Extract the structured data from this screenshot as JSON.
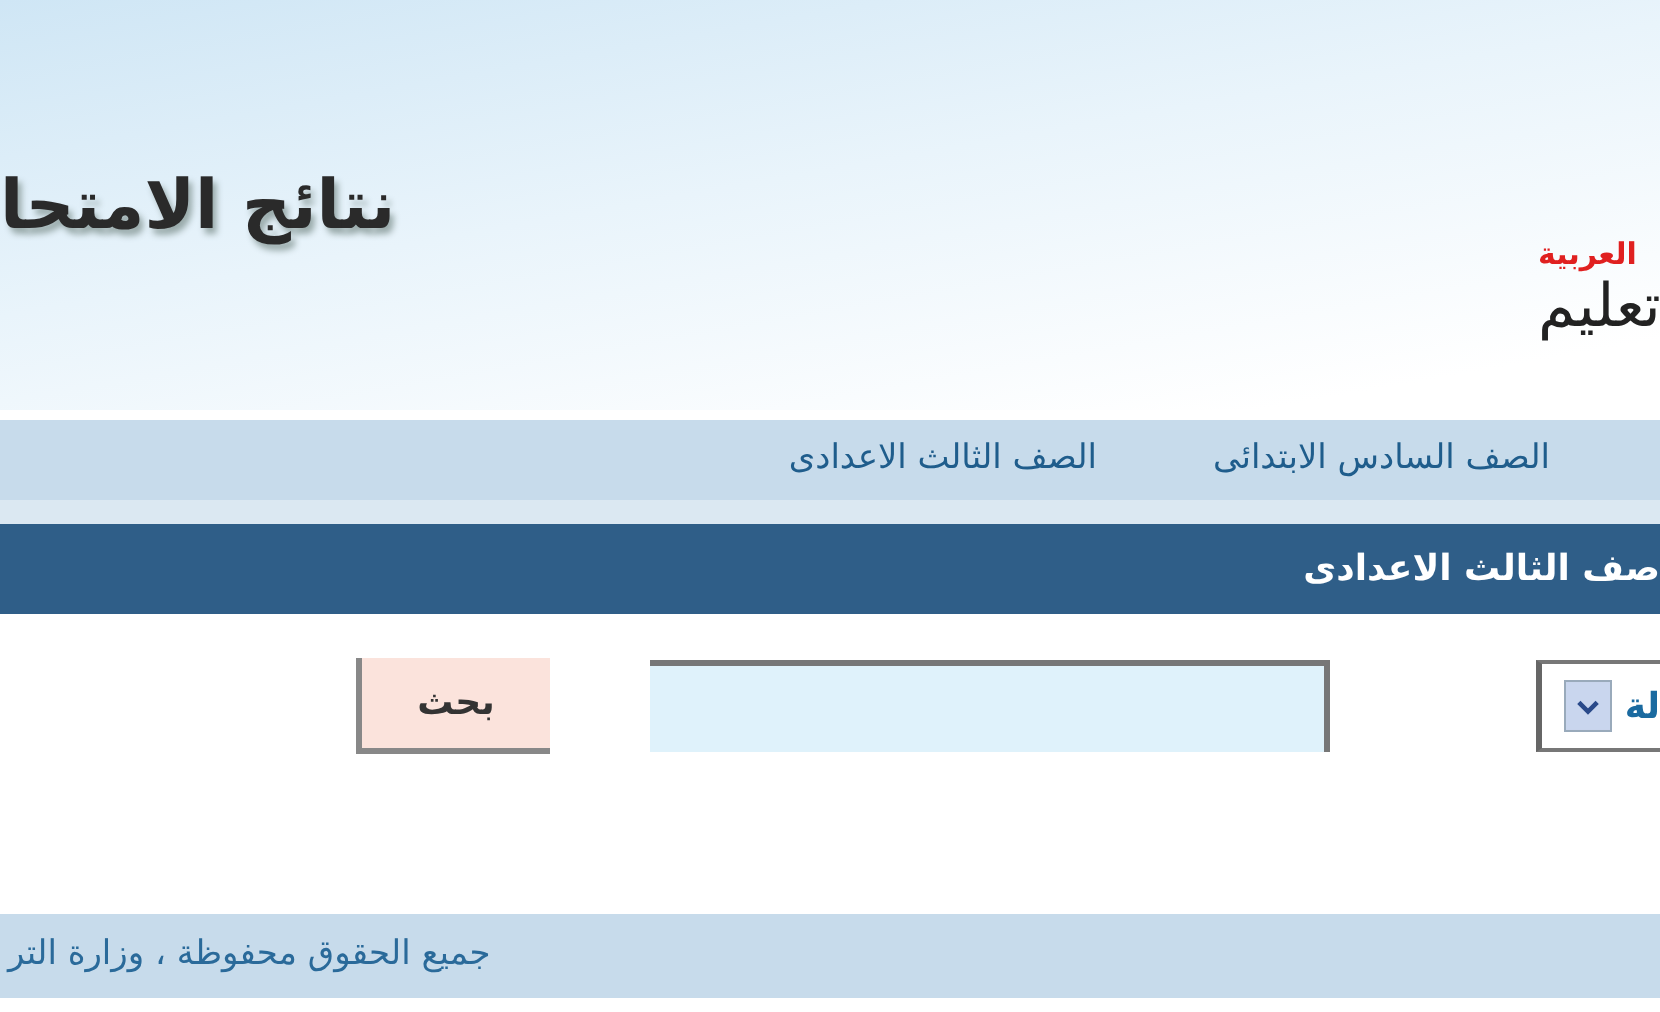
{
  "header": {
    "title": "نتائج الامتحا",
    "logo": {
      "caption": "العربية",
      "wordmark": "تعليم"
    }
  },
  "nav": [
    {
      "label": "الصف السادس الابتدائى"
    },
    {
      "label": "الصف الثالث الاعدادى"
    }
  ],
  "section": {
    "title": "صف الثالث الاعدادى"
  },
  "search_form": {
    "select_value": "لة",
    "button": "بحث"
  },
  "footer": {
    "text": "جميع الحقوق محفوظة ، وزارة التر"
  }
}
